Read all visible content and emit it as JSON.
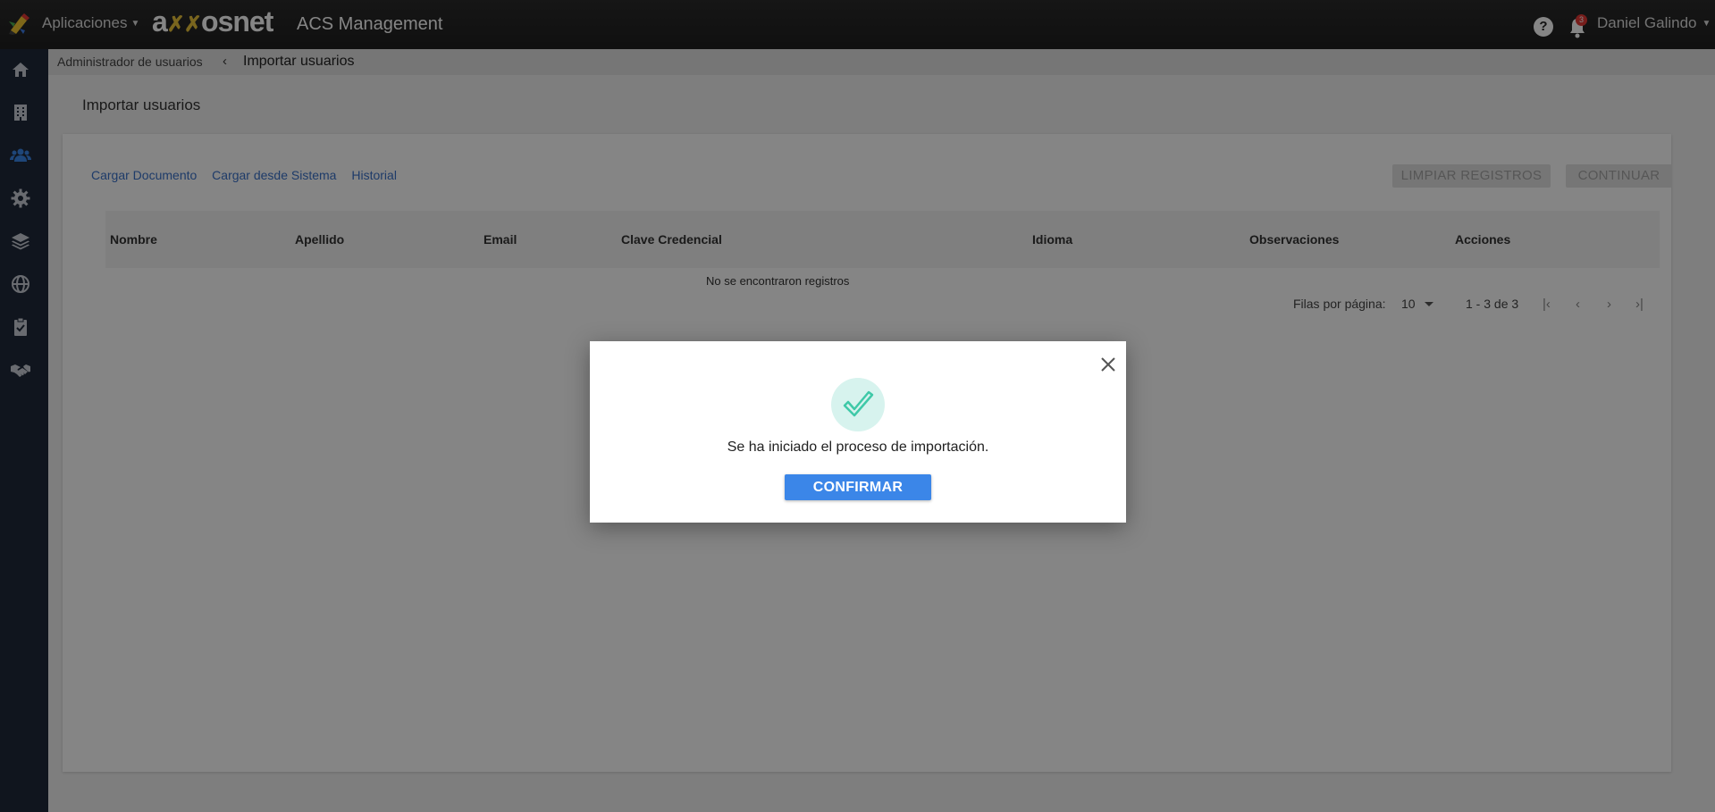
{
  "topbar": {
    "apps_label": "Aplicaciones",
    "brand_left": "a",
    "brand_mid": "✗✗",
    "brand_right": "osnet",
    "app_title": "ACS Management",
    "help_glyph": "?",
    "notification_count": "3",
    "user_name": "Daniel Galindo"
  },
  "sidebar": {
    "items": [
      "home-icon",
      "building-icon",
      "users-icon",
      "gear-icon",
      "layers-icon",
      "globe-icon",
      "clipboard-check-icon",
      "handshake-icon"
    ],
    "active": "users-icon"
  },
  "breadcrumb": {
    "parent": "Administrador de usuarios",
    "separator": "‹",
    "current": "Importar usuarios"
  },
  "page": {
    "title": "Importar usuarios",
    "tabs": [
      "Cargar Documento",
      "Cargar desde Sistema",
      "Historial"
    ],
    "clear_button": "LIMPIAR REGISTROS",
    "continue_button": "CONTINUAR"
  },
  "table": {
    "columns": [
      "Nombre",
      "Apellido",
      "Email",
      "Clave Credencial",
      "Idioma",
      "Observaciones",
      "Acciones"
    ],
    "empty_message": "No se encontraron registros"
  },
  "pagination": {
    "rows_label": "Filas por página:",
    "rows_value": "10",
    "range": "1 - 3 de 3",
    "first": "|‹",
    "prev": "‹",
    "next": "›",
    "last": "›|"
  },
  "modal": {
    "message": "Se ha iniciado el proceso de importación.",
    "confirm_label": "CONFIRMAR",
    "close_glyph": "×"
  },
  "colors": {
    "accent": "#3b86e8",
    "link": "#3a72c9",
    "sidebar": "#1f2a3a",
    "success": "#3fc9a8"
  }
}
